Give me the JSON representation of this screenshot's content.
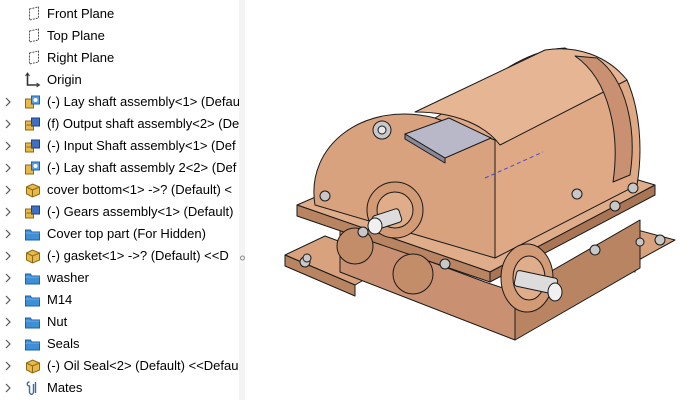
{
  "feature_tree": {
    "items": [
      {
        "label": "Front Plane",
        "icon": "plane-icon",
        "expandable": false
      },
      {
        "label": "Top Plane",
        "icon": "plane-icon",
        "expandable": false
      },
      {
        "label": "Right Plane",
        "icon": "plane-icon",
        "expandable": false
      },
      {
        "label": "Origin",
        "icon": "origin-icon",
        "expandable": false
      },
      {
        "label": "(-) Lay shaft assembly<1> (Default",
        "icon": "assembly-icon",
        "expandable": true
      },
      {
        "label": "(f) Output shaft assembly<2> (De",
        "icon": "assembly-fixed-icon",
        "expandable": true
      },
      {
        "label": "(-) Input Shaft assembly<1> (Def",
        "icon": "assembly-fixed-icon",
        "expandable": true
      },
      {
        "label": "(-) Lay shaft assembly 2<2> (Def",
        "icon": "assembly-icon",
        "expandable": true
      },
      {
        "label": "cover bottom<1> ->? (Default) <",
        "icon": "part-icon",
        "expandable": true
      },
      {
        "label": "(-) Gears assembly<1> (Default)",
        "icon": "assembly-fixed-icon",
        "expandable": true
      },
      {
        "label": "Cover top part (For Hidden)",
        "icon": "folder-icon",
        "expandable": true
      },
      {
        "label": "(-) gasket<1> ->? (Default) <<D",
        "icon": "part-icon",
        "expandable": true
      },
      {
        "label": "washer",
        "icon": "folder-icon",
        "expandable": true
      },
      {
        "label": "M14",
        "icon": "folder-icon",
        "expandable": true
      },
      {
        "label": "Nut",
        "icon": "folder-icon",
        "expandable": true
      },
      {
        "label": "Seals",
        "icon": "folder-icon",
        "expandable": true
      },
      {
        "label": "(-) Oil Seal<2> (Default) <<Defau",
        "icon": "part-icon",
        "expandable": true
      },
      {
        "label": "Mates",
        "icon": "mates-icon",
        "expandable": true
      }
    ]
  },
  "colors": {
    "housing": "#d9a27e",
    "housing_shadow": "#b98462",
    "edges": "#1a1a1a",
    "steel": "#d0d0d0",
    "folder": "#3d8fd6",
    "part": "#e8b84a",
    "assembly_blue": "#3d6fc4"
  },
  "viewport": {
    "model": "gearbox-assembly"
  }
}
